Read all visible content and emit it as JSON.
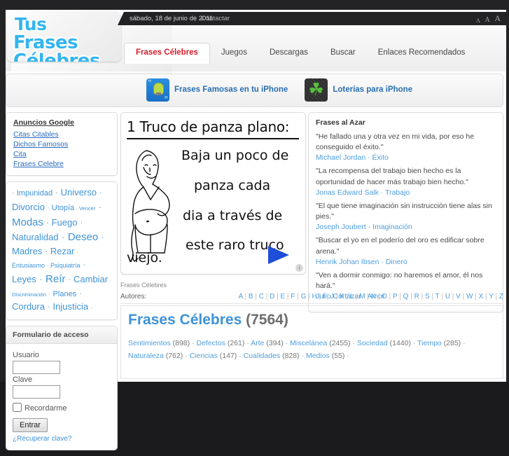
{
  "site": {
    "logo_line1": "Tus",
    "logo_line2": "Frases Célebres",
    "date": "sábado, 18 de junio de 2011",
    "separator": "|",
    "contactar": "Contactar",
    "fontsize_small": "A",
    "fontsize_medium": "A",
    "fontsize_large": "A"
  },
  "nav": {
    "tabs": [
      {
        "label": "Frases Célebres",
        "active": true
      },
      {
        "label": "Juegos",
        "active": false
      },
      {
        "label": "Descargas",
        "active": false
      },
      {
        "label": "Buscar",
        "active": false
      },
      {
        "label": "Enlaces Recomendados",
        "active": false
      }
    ]
  },
  "promo": {
    "items": [
      {
        "label": "Frases Famosas en tu iPhone",
        "icon": "lightbulb-quote-icon"
      },
      {
        "label": "Loterías para iPhone",
        "icon": "clover-icon"
      }
    ]
  },
  "ads_box": {
    "title": "Anuncios Google",
    "links": [
      "Citas Citables",
      "Dichos Famosos",
      "Cita",
      "Frases Celebre"
    ]
  },
  "tag_cloud": {
    "tags": [
      {
        "label": "Impunidad",
        "size": "s-md"
      },
      {
        "label": "Universo",
        "size": "s-lg"
      },
      {
        "label": "Divorcio",
        "size": "s-lg"
      },
      {
        "label": "Utopía",
        "size": "s-md"
      },
      {
        "label": "Vencer",
        "size": "s-xs"
      },
      {
        "label": "Modas",
        "size": "s-xl"
      },
      {
        "label": "Fuego",
        "size": "s-lg"
      },
      {
        "label": "Naturalidad",
        "size": "s-lg"
      },
      {
        "label": "Deseo",
        "size": "s-xl"
      },
      {
        "label": "Madres",
        "size": "s-lg"
      },
      {
        "label": "Rezar",
        "size": "s-lg"
      },
      {
        "label": "Entusiasmo",
        "size": "s-sm"
      },
      {
        "label": "Psiquiatría",
        "size": "s-sm"
      },
      {
        "label": "Leyes",
        "size": "s-lg"
      },
      {
        "label": "Reír",
        "size": "s-xl"
      },
      {
        "label": "Cambiar",
        "size": "s-lg"
      },
      {
        "label": "Discriminación",
        "size": "s-xs"
      },
      {
        "label": "Planes",
        "size": "s-md"
      },
      {
        "label": "Cordura",
        "size": "s-lg"
      },
      {
        "label": "Injusticia",
        "size": "s-lg"
      }
    ],
    "separator": "·"
  },
  "login": {
    "title": "Formulario de acceso",
    "user_label": "Usuario",
    "user_value": "",
    "pass_label": "Clave",
    "pass_value": "",
    "remember_label": "Recordarme",
    "submit_label": "Entrar",
    "recover_label": "¿Recuperar clave?"
  },
  "center_ad": {
    "line1": "1 Truco de panza plano:",
    "line2": "Baja un poco de",
    "line3": "panza cada",
    "line4": "dia a través de",
    "line5": "este raro truco",
    "line6": "viejo.",
    "badge": "i",
    "arrow": "blue-arrow-icon",
    "figure": "woman-illustration"
  },
  "random_quotes": {
    "title": "Frases al Azar",
    "items": [
      {
        "text": "\"He fallado una y otra vez en mi vida, por eso he conseguido el éxito.\"",
        "author": "Michael Jordan",
        "topic": "Éxito"
      },
      {
        "text": "\"La recompensa del trabajo bien hecho es la oportunidad de hacer más trabajo bien hecho.\"",
        "author": "Jonas Edward Salk",
        "topic": "Trabajo"
      },
      {
        "text": "\"El que tiene imaginación sin instrucción tiene alas sin pies.\"",
        "author": "Joseph Joubert",
        "topic": "Imaginación"
      },
      {
        "text": "\"Buscar el yo en el poderío del oro es edificar sobre arena.\"",
        "author": "Henrik Johan Ibsen",
        "topic": "Dinero"
      },
      {
        "text": "\"Ven a dormir conmigo: no haremos el amor, él nos hará.\"",
        "author": "Julio Cortázar",
        "topic": "Amor"
      }
    ],
    "separator": "·"
  },
  "main": {
    "breadcrumb": "Frases Célebres",
    "autores_label": "Autores:",
    "alphabet": [
      "A",
      "B",
      "C",
      "D",
      "E",
      "F",
      "G",
      "H",
      "I",
      "J",
      "K",
      "L",
      "M",
      "N",
      "O",
      "P",
      "Q",
      "R",
      "S",
      "T",
      "U",
      "V",
      "W",
      "X",
      "Y",
      "Z"
    ],
    "title": "Frases Célebres",
    "count": "(7564)",
    "categories": [
      {
        "label": "Sentimientos",
        "count": "(898)"
      },
      {
        "label": "Defectos",
        "count": "(261)"
      },
      {
        "label": "Arte",
        "count": "(394)"
      },
      {
        "label": "Miscelánea",
        "count": "(2455)"
      },
      {
        "label": "Sociedad",
        "count": "(1440)"
      },
      {
        "label": "Tiempo",
        "count": "(285)"
      },
      {
        "label": "Naturaleza",
        "count": "(762)"
      },
      {
        "label": "Ciencias",
        "count": "(147)"
      },
      {
        "label": "Cualidades",
        "count": "(828)"
      },
      {
        "label": "Medios",
        "count": "(55)"
      }
    ],
    "separator": "·"
  },
  "colors": {
    "link_blue": "#4f9ede",
    "accent_red": "#d3202a",
    "logo_blue": "#33b5f0",
    "dark_bar": "#232326"
  }
}
